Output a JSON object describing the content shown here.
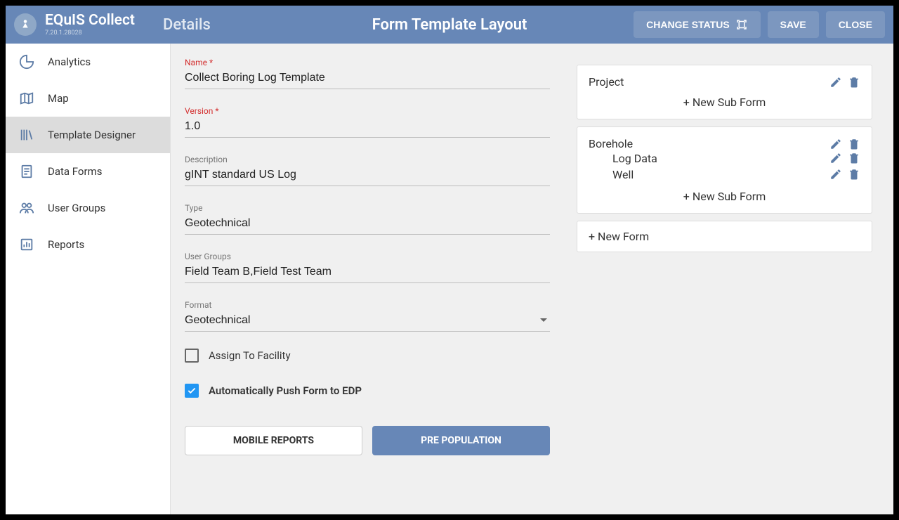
{
  "header": {
    "appTitle": "EQuIS Collect",
    "appVersion": "7.20.1.28028",
    "detailsTitle": "Details",
    "layoutTitle": "Form Template Layout",
    "changeStatus": "CHANGE STATUS",
    "save": "SAVE",
    "close": "CLOSE"
  },
  "sidebar": {
    "items": [
      {
        "label": "Analytics"
      },
      {
        "label": "Map"
      },
      {
        "label": "Template Designer"
      },
      {
        "label": "Data Forms"
      },
      {
        "label": "User Groups"
      },
      {
        "label": "Reports"
      }
    ]
  },
  "fields": {
    "nameLabel": "Name",
    "nameValue": "Collect Boring Log Template",
    "versionLabel": "Version",
    "versionValue": "1.0",
    "descLabel": "Description",
    "descValue": "gINT standard US Log",
    "typeLabel": "Type",
    "typeValue": "Geotechnical",
    "groupsLabel": "User Groups",
    "groupsValue": "Field Team B,Field Test Team",
    "formatLabel": "Format",
    "formatValue": "Geotechnical",
    "assignLabel": "Assign To Facility",
    "pushLabel": "Automatically Push Form to EDP"
  },
  "actions": {
    "mobileReports": "MOBILE REPORTS",
    "prePopulation": "PRE POPULATION"
  },
  "layout": {
    "projectTitle": "Project",
    "newSubForm": "+ New Sub Form",
    "boreholeTitle": "Borehole",
    "logData": "Log Data",
    "well": "Well",
    "newForm": "+ New Form"
  }
}
